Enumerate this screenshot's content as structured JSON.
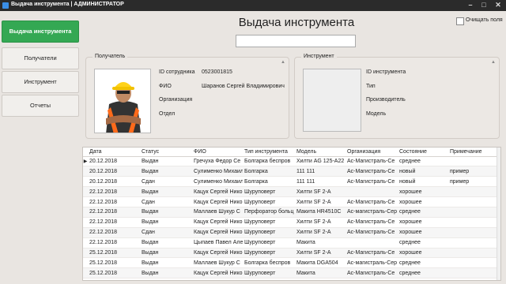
{
  "window": {
    "title": "Выдача инструмента | АДМИНИСТРАТОР"
  },
  "sidebar": {
    "items": [
      {
        "label": "Выдача инструмента"
      },
      {
        "label": "Получатели"
      },
      {
        "label": "Инструмент"
      },
      {
        "label": "Отчеты"
      }
    ]
  },
  "header": {
    "title": "Выдача инструмента",
    "clear_fields_label": "Очищать поля",
    "search_value": ""
  },
  "recipient": {
    "group_title": "Получатель",
    "labels": {
      "id": "ID сотрудника",
      "fio": "ФИО",
      "org": "Организация",
      "dept": "Отдел"
    },
    "values": {
      "id": "0523001815",
      "fio": "Шаранов Сергей Владимирович",
      "org": "",
      "dept": ""
    }
  },
  "tool": {
    "group_title": "Инструмент",
    "labels": {
      "id": "ID инструмента",
      "type": "Тип",
      "maker": "Производитель",
      "model": "Модель"
    }
  },
  "grid": {
    "columns": [
      "Дата",
      "Статус",
      "ФИО",
      "Тип инструмента",
      "Модель",
      "Организация",
      "Состояние",
      "Примечание"
    ],
    "rows": [
      [
        "20.12.2018",
        "Выдан",
        "Гречуха Федор Се",
        "Болгарка беспров",
        "Хилти AG 125-A22",
        "Ас-Магистраль-Се",
        "среднее",
        ""
      ],
      [
        "20.12.2018",
        "Выдан",
        "Сулименко Михаил",
        "Болгарка",
        "111 111",
        "Ас-Магистраль-Се",
        "новый",
        "пример"
      ],
      [
        "20.12.2018",
        "Сдан",
        "Сулименко Михаил",
        "Болгарка",
        "111 111",
        "Ас-Магистраль-Се",
        "новый",
        "пример"
      ],
      [
        "22.12.2018",
        "Выдан",
        "Кацук Сергей Нико",
        "Шуруповерт",
        "Хилти SF 2-A",
        "",
        "хорошее",
        ""
      ],
      [
        "22.12.2018",
        "Сдан",
        "Кацук Сергей Нико",
        "Шуруповерт",
        "Хилти SF 2-A",
        "Ас-Магистраль-Се",
        "хорошее",
        ""
      ],
      [
        "22.12.2018",
        "Выдан",
        "Маллаев Шукур С",
        "Перфоратор больц",
        "Макита HR4510C",
        "Ас-магистраль-Сер",
        "среднее",
        ""
      ],
      [
        "22.12.2018",
        "Выдан",
        "Кацук Сергей Нико",
        "Шуруповерт",
        "Хилти SF 2-A",
        "Ас-Магистраль-Се",
        "хорошее",
        ""
      ],
      [
        "22.12.2018",
        "Сдан",
        "Кацук Сергей Нико",
        "Шуруповерт",
        "Хилти SF 2-A",
        "Ас-Магистраль-Се",
        "хорошее",
        ""
      ],
      [
        "22.12.2018",
        "Выдан",
        "Цыпаев Павел Але",
        "Шуруповерт",
        "Макита",
        "",
        "среднее",
        ""
      ],
      [
        "25.12.2018",
        "Выдан",
        "Кацук Сергей Нико",
        "Шуруповерт",
        "Хилти SF 2-A",
        "Ас-Магистраль-Се",
        "хорошее",
        ""
      ],
      [
        "25.12.2018",
        "Выдан",
        "Маллаев Шукур С",
        "Болгарка беспров",
        "Макита DGA504",
        "Ас-магистраль-Сер",
        "среднее",
        ""
      ],
      [
        "25.12.2018",
        "Выдан",
        "Кацук Сергей Нико",
        "Шуруповерт",
        "Макита",
        "Ас-Магистраль-Се",
        "среднее",
        ""
      ]
    ]
  }
}
